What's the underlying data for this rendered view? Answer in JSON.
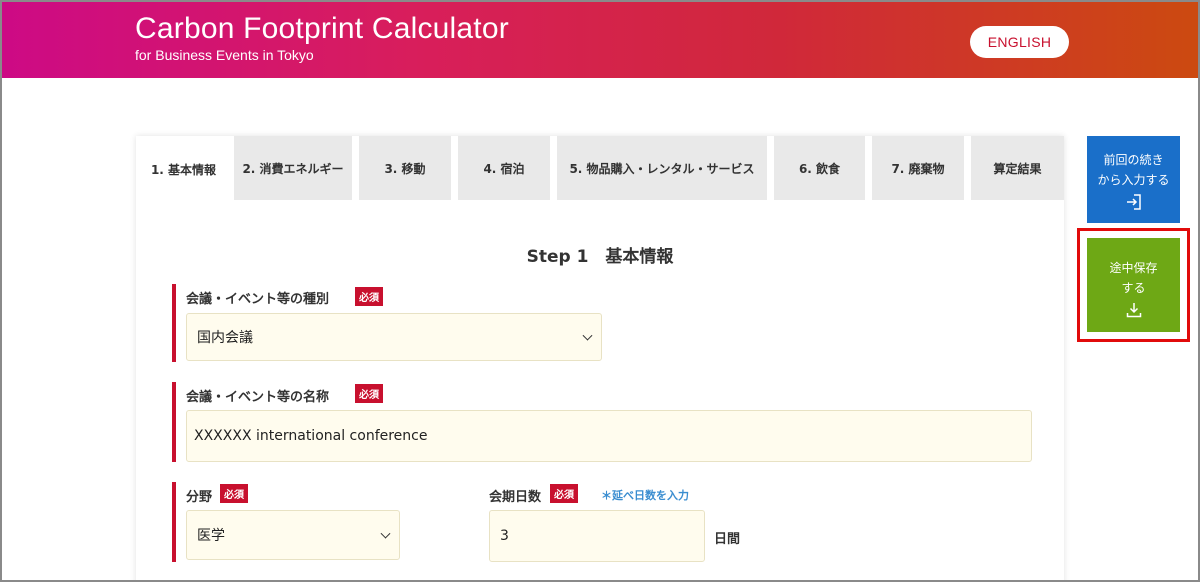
{
  "header": {
    "title": "Carbon Footprint Calculator",
    "subtitle": "for Business Events in Tokyo",
    "language_button": "ENGLISH"
  },
  "tabs": [
    {
      "label": "1. 基本情報",
      "active": true
    },
    {
      "label": "2. 消費エネルギー",
      "active": false
    },
    {
      "label": "3. 移動",
      "active": false
    },
    {
      "label": "4. 宿泊",
      "active": false
    },
    {
      "label": "5. 物品購入・レンタル・サービス",
      "active": false
    },
    {
      "label": "6. 飲食",
      "active": false
    },
    {
      "label": "7. 廃棄物",
      "active": false
    },
    {
      "label": "算定結果",
      "active": false
    }
  ],
  "step_title": "Step 1　基本情報",
  "form": {
    "event_type": {
      "label": "会議・イベント等の種別",
      "required": "必須",
      "value": "国内会議"
    },
    "event_name": {
      "label": "会議・イベント等の名称",
      "required": "必須",
      "value": "XXXXXX international conference"
    },
    "field": {
      "label": "分野",
      "required": "必須",
      "value": "医学"
    },
    "duration": {
      "label": "会期日数",
      "required": "必須",
      "hint": "＊延べ日数を入力",
      "value": "3",
      "unit": "日間"
    }
  },
  "side": {
    "resume_label_1": "前回の続き",
    "resume_label_2": "から入力する",
    "resume_icon": "login-arrow-icon",
    "save_label_1": "途中保存",
    "save_label_2": "する",
    "save_icon": "download-icon"
  },
  "colors": {
    "accent_red": "#c8102e",
    "resume_blue": "#1a6fc9",
    "save_green": "#6ea815",
    "highlight_red": "#e10b0b",
    "input_background": "#fffcee"
  }
}
